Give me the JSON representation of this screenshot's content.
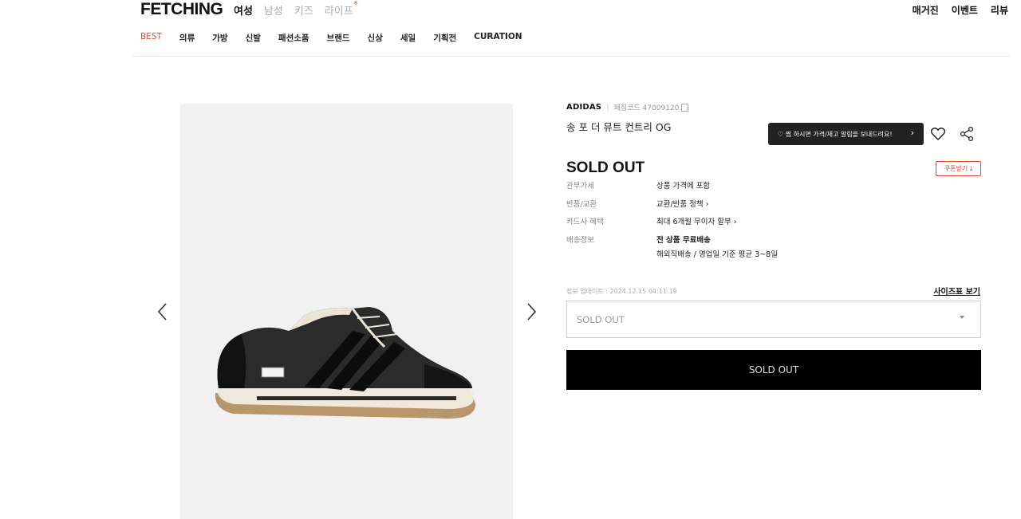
{
  "header": {
    "logo": "FETCHING",
    "gender_tabs": [
      {
        "label": "여성",
        "active": true
      },
      {
        "label": "남성",
        "active": false
      },
      {
        "label": "키즈",
        "active": false
      },
      {
        "label": "라이프",
        "active": false,
        "badge": "*"
      }
    ],
    "top_links": [
      "매거진",
      "이벤트",
      "리뷰"
    ],
    "categories": [
      "BEST",
      "의류",
      "가방",
      "신발",
      "패션소품",
      "브랜드",
      "신상",
      "세일",
      "기획전",
      "CURATION"
    ]
  },
  "product": {
    "brand": "ADIDAS",
    "code_label": "페칭코드 47009120",
    "name": "송 포 더 뮤트 컨트리 OG",
    "status_title": "SOLD OUT",
    "coupon_label": "쿠폰받기 ⤓",
    "tooltip": "♡ 찜 하시면 가격/재고 알림을 보내드려요!",
    "specs": [
      {
        "key": "관부가세",
        "value": "상품 가격에 포함"
      },
      {
        "key": "반품/교환",
        "value": "교환/반품 정책 ›"
      },
      {
        "key": "카드사 혜택",
        "value": "최대 6개월 무이자 할부 ›"
      },
      {
        "key": "배송정보",
        "value": "전 상품 무료배송",
        "sub": "해외직배송 / 영업일 기준 평균 3~8일"
      }
    ],
    "update_text": "정보 업데이트 : 2024.12.15 04:11:19",
    "size_guide": "사이즈표 보기",
    "size_select_value": "SOLD OUT",
    "cta_label": "SOLD OUT"
  },
  "colors": {
    "accent": "#e8452c",
    "cta_bg": "#000000",
    "gallery_bg": "#f1f1f1"
  },
  "icons": [
    "chevron-left-icon",
    "chevron-right-icon",
    "heart-icon",
    "share-icon",
    "copy-icon",
    "caret-down-icon"
  ]
}
